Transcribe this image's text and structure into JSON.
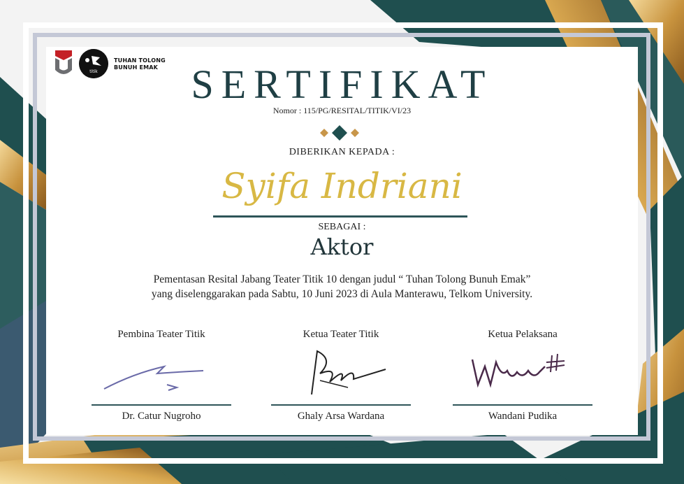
{
  "logos": {
    "institution_logo": "university-u-logo",
    "titik_logo_text": "titik",
    "play_title": "TUHAN TOLONG BUNUH EMAK"
  },
  "certificate": {
    "title": "SERTIFIKAT",
    "number": "Nomor : 115/PG/RESITAL/TITIK/VI/23",
    "given_to_label": "DIBERIKAN KEPADA :",
    "recipient_name": "Syifa Indriani",
    "as_label": "SEBAGAI :",
    "role": "Aktor",
    "description_line1": "Pementasan Resital Jabang Teater Titik 10 dengan judul “ Tuhan Tolong Bunuh Emak”",
    "description_line2": "yang diselenggarakan pada Sabtu, 10 Juni 2023 di Aula Manterawu, Telkom University."
  },
  "signatures": [
    {
      "role": "Pembina Teater Titik",
      "name": "Dr. Catur Nugroho"
    },
    {
      "role": "Ketua Teater Titik",
      "name": "Ghaly Arsa Wardana"
    },
    {
      "role": "Ketua Pelaksana",
      "name": "Wandani Pudika"
    }
  ],
  "colors": {
    "teal": "#1f4f4f",
    "gold": "#d8b844",
    "bronze": "#c8964a",
    "title": "#1f3f44",
    "frame_grey": "#c4c8d6"
  }
}
